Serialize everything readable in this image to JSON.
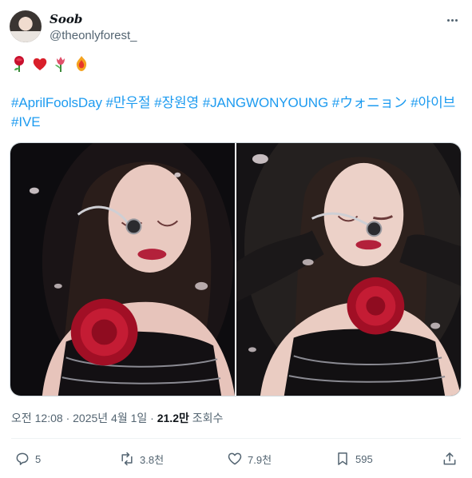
{
  "author": {
    "display_name": "Soob",
    "handle": "@theonlyforest_"
  },
  "emojis": [
    "rose",
    "red-heart",
    "tulip",
    "fire-flower"
  ],
  "hashtags": [
    "#AprilFoolsDay",
    "#만우절",
    "#장원영",
    "#JANGWONYOUNG",
    "#ウォニョン",
    "#아이브",
    "#IVE"
  ],
  "meta": {
    "time": "오전 12:08",
    "separator": "·",
    "date": "2025년 4월 1일",
    "views_count": "21.2만",
    "views_label": "조회수"
  },
  "actions": {
    "reply": "5",
    "repost": "3.8천",
    "like": "7.9천",
    "bookmark": "595"
  },
  "colors": {
    "link": "#1d9bf0",
    "secondary_text": "#536471",
    "rose": "#c8102e"
  }
}
